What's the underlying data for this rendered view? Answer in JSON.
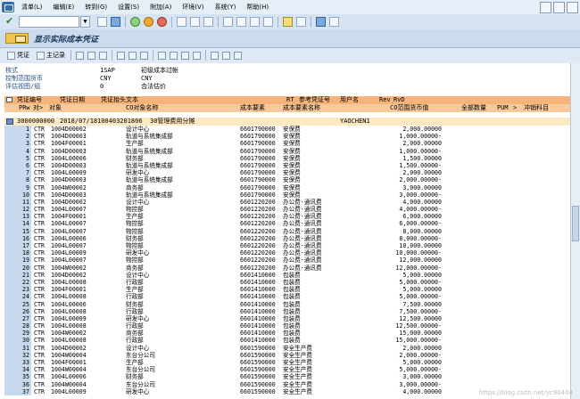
{
  "menubar": {
    "items": [
      "清单(L)",
      "编辑(E)",
      "转到(G)",
      "设置(S)",
      "附加(A)",
      "环境(V)",
      "系统(Y)",
      "帮助(H)"
    ]
  },
  "page": {
    "title": "显示实际成本凭证"
  },
  "toolbar2": {
    "voucher": "凭证",
    "master": "主记录"
  },
  "header": {
    "rows": [
      {
        "label": "核式",
        "value": "1SAP",
        "desc": "初级成本过帐"
      },
      {
        "label": "控制范围货币",
        "value": "CNY",
        "desc": "CNY"
      },
      {
        "label": "评估视图/组",
        "value": "0",
        "desc": "合法估价"
      }
    ]
  },
  "columns": {
    "row1": [
      "凭证编号",
      "凭证日期",
      "凭证抬头文本",
      "RT",
      "参考凭证号",
      "用户名",
      "Rev",
      "RvD"
    ],
    "row2": [
      "PRw",
      "对>",
      "对象",
      "CO对象名称",
      "成本要素",
      "成本要素名称",
      "CO范围货币值",
      "全部数量",
      "PUM",
      ">",
      "冲销科目"
    ]
  },
  "doc": {
    "number": "3000000000",
    "date": "2018/07/18",
    "text": "100403201806",
    "text2": "30管理费用分摊",
    "user": "YAOCHEN1"
  },
  "rows": [
    [
      "1",
      "CTR",
      "1004D00002",
      "设计中心",
      "6601790000",
      "安保费",
      "2,000.00000"
    ],
    [
      "2",
      "CTR",
      "1004D00003",
      "轨道与系统集成部",
      "6601790000",
      "安保费",
      "1,000.00000-"
    ],
    [
      "3",
      "CTR",
      "1004F00001",
      "生产部",
      "6601790000",
      "安保费",
      "2,000.00000"
    ],
    [
      "4",
      "CTR",
      "1004D00003",
      "轨道与系统集成部",
      "6601790000",
      "安保费",
      "1,000.00000-"
    ],
    [
      "5",
      "CTR",
      "1004L00006",
      "财务部",
      "6601790000",
      "安保费",
      "1,500.00000"
    ],
    [
      "6",
      "CTR",
      "1004D00003",
      "轨道与系统集成部",
      "6601790000",
      "安保费",
      "1,500.00000-"
    ],
    [
      "7",
      "CTR",
      "1004L00009",
      "研发中心",
      "6601790000",
      "安保费",
      "2,000.00000"
    ],
    [
      "8",
      "CTR",
      "1004D00003",
      "轨道与系统集成部",
      "6601790000",
      "安保费",
      "2,000.00000-"
    ],
    [
      "9",
      "CTR",
      "1004W00002",
      "商务部",
      "6601790000",
      "安保费",
      "3,000.00000"
    ],
    [
      "10",
      "CTR",
      "1004D00003",
      "轨道与系统集成部",
      "6601790000",
      "安保费",
      "3,000.00000-"
    ],
    [
      "11",
      "CTR",
      "1004D00002",
      "设计中心",
      "6601220200",
      "办公费-通讯费",
      "4,000.00000"
    ],
    [
      "12",
      "CTR",
      "1004L00007",
      "物控部",
      "6601220200",
      "办公费-通讯费",
      "4,000.00000-"
    ],
    [
      "13",
      "CTR",
      "1004F00001",
      "生产部",
      "6601220200",
      "办公费-通讯费",
      "6,000.00000"
    ],
    [
      "14",
      "CTR",
      "1004L00007",
      "物控部",
      "6601220200",
      "办公费-通讯费",
      "6,000.00000-"
    ],
    [
      "15",
      "CTR",
      "1004L00007",
      "物控部",
      "6601220200",
      "办公费-通讯费",
      "8,000.00000"
    ],
    [
      "16",
      "CTR",
      "1004L00006",
      "财务部",
      "6601220200",
      "办公费-通讯费",
      "8,000.00000-"
    ],
    [
      "17",
      "CTR",
      "1004L00007",
      "物控部",
      "6601220200",
      "办公费-通讯费",
      "10,000.00000"
    ],
    [
      "18",
      "CTR",
      "1004L00009",
      "研发中心",
      "6601220200",
      "办公费-通讯费",
      "10,000.00000-"
    ],
    [
      "19",
      "CTR",
      "1004L00007",
      "物控部",
      "6601220200",
      "办公费-通讯费",
      "12,000.00000"
    ],
    [
      "20",
      "CTR",
      "1004W00002",
      "商务部",
      "6601220200",
      "办公费-通讯费",
      "12,000.00000-"
    ],
    [
      "21",
      "CTR",
      "1004D00002",
      "设计中心",
      "6601410000",
      "包装费",
      "5,000.00000"
    ],
    [
      "22",
      "CTR",
      "1004L00008",
      "行政部",
      "6601410000",
      "包装费",
      "5,000.00000-"
    ],
    [
      "23",
      "CTR",
      "1004F00001",
      "生产部",
      "6601410000",
      "包装费",
      "5,000.00000"
    ],
    [
      "24",
      "CTR",
      "1004L00008",
      "行政部",
      "6601410000",
      "包装费",
      "5,000.00000-"
    ],
    [
      "25",
      "CTR",
      "1004L00006",
      "财务部",
      "6601410000",
      "包装费",
      "7,500.00000"
    ],
    [
      "26",
      "CTR",
      "1004L00008",
      "行政部",
      "6601410000",
      "包装费",
      "7,500.00000-"
    ],
    [
      "27",
      "CTR",
      "1004L00009",
      "研发中心",
      "6601410000",
      "包装费",
      "12,500.00000"
    ],
    [
      "28",
      "CTR",
      "1004L00008",
      "行政部",
      "6601410000",
      "包装费",
      "12,500.00000-"
    ],
    [
      "29",
      "CTR",
      "1004W00002",
      "商务部",
      "6601410000",
      "包装费",
      "15,000.00000"
    ],
    [
      "30",
      "CTR",
      "1004L00008",
      "行政部",
      "6601410000",
      "包装费",
      "15,000.00000-"
    ],
    [
      "31",
      "CTR",
      "1004D00002",
      "设计中心",
      "6601590000",
      "安全生产费",
      "2,000.00000"
    ],
    [
      "32",
      "CTR",
      "1004W00004",
      "东台分公司",
      "6601590000",
      "安全生产费",
      "2,000.00000-"
    ],
    [
      "33",
      "CTR",
      "1004F00001",
      "生产部",
      "6601590000",
      "安全生产费",
      "5,000.00000"
    ],
    [
      "34",
      "CTR",
      "1004W00004",
      "东台分公司",
      "6601590000",
      "安全生产费",
      "5,000.00000-"
    ],
    [
      "35",
      "CTR",
      "1004L00006",
      "财务部",
      "6601590000",
      "安全生产费",
      "3,000.00000"
    ],
    [
      "36",
      "CTR",
      "1004W00004",
      "东台分公司",
      "6601590000",
      "安全生产费",
      "3,000.00000-"
    ],
    [
      "37",
      "CTR",
      "1004L00009",
      "研发中心",
      "6601590000",
      "安全生产费",
      "4,000.00000"
    ]
  ],
  "watermark": "https://blog.csdn.net/yc90404"
}
